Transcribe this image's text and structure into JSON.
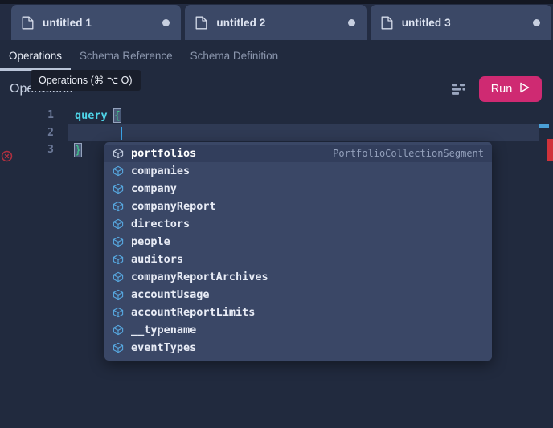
{
  "window": {
    "theme_bg": "#212a3e",
    "accent": "#cf2a72"
  },
  "tabs": [
    {
      "label": "untitled 1",
      "icon": "document-icon",
      "dot": "unsaved-dot",
      "active": true
    },
    {
      "label": "untitled 2",
      "icon": "document-icon",
      "dot": "unsaved-dot",
      "active": false
    },
    {
      "label": "untitled 3",
      "icon": "document-icon",
      "dot": "unsaved-dot",
      "active": false
    }
  ],
  "nav": {
    "items": [
      {
        "label": "Operations",
        "active": true
      },
      {
        "label": "Schema Reference",
        "active": false
      },
      {
        "label": "Schema Definition",
        "active": false
      }
    ]
  },
  "tooltip": {
    "text": "Operations (⌘ ⌥ O)"
  },
  "pane": {
    "title": "Operations",
    "format_icon": "prettify-icon",
    "run_label": "Run",
    "run_icon": "play-icon"
  },
  "editor": {
    "lines": [
      {
        "number": "1",
        "text": "query {",
        "error": false
      },
      {
        "number": "2",
        "text": "",
        "error": false
      },
      {
        "number": "3",
        "text": "}",
        "error": true
      }
    ],
    "error_icon": "error-circle-icon",
    "cursor_line": 2
  },
  "autocomplete": {
    "items": [
      {
        "label": "portfolios",
        "type": "PortfolioCollectionSegment",
        "icon": "cube-icon",
        "selected": true
      },
      {
        "label": "companies",
        "type": "",
        "icon": "cube-icon",
        "selected": false
      },
      {
        "label": "company",
        "type": "",
        "icon": "cube-icon",
        "selected": false
      },
      {
        "label": "companyReport",
        "type": "",
        "icon": "cube-icon",
        "selected": false
      },
      {
        "label": "directors",
        "type": "",
        "icon": "cube-icon",
        "selected": false
      },
      {
        "label": "people",
        "type": "",
        "icon": "cube-icon",
        "selected": false
      },
      {
        "label": "auditors",
        "type": "",
        "icon": "cube-icon",
        "selected": false
      },
      {
        "label": "companyReportArchives",
        "type": "",
        "icon": "cube-icon",
        "selected": false
      },
      {
        "label": "accountUsage",
        "type": "",
        "icon": "cube-icon",
        "selected": false
      },
      {
        "label": "accountReportLimits",
        "type": "",
        "icon": "cube-icon",
        "selected": false
      },
      {
        "label": "__typename",
        "type": "",
        "icon": "cube-icon",
        "selected": false
      },
      {
        "label": "eventTypes",
        "type": "",
        "icon": "cube-icon",
        "selected": false
      }
    ]
  }
}
